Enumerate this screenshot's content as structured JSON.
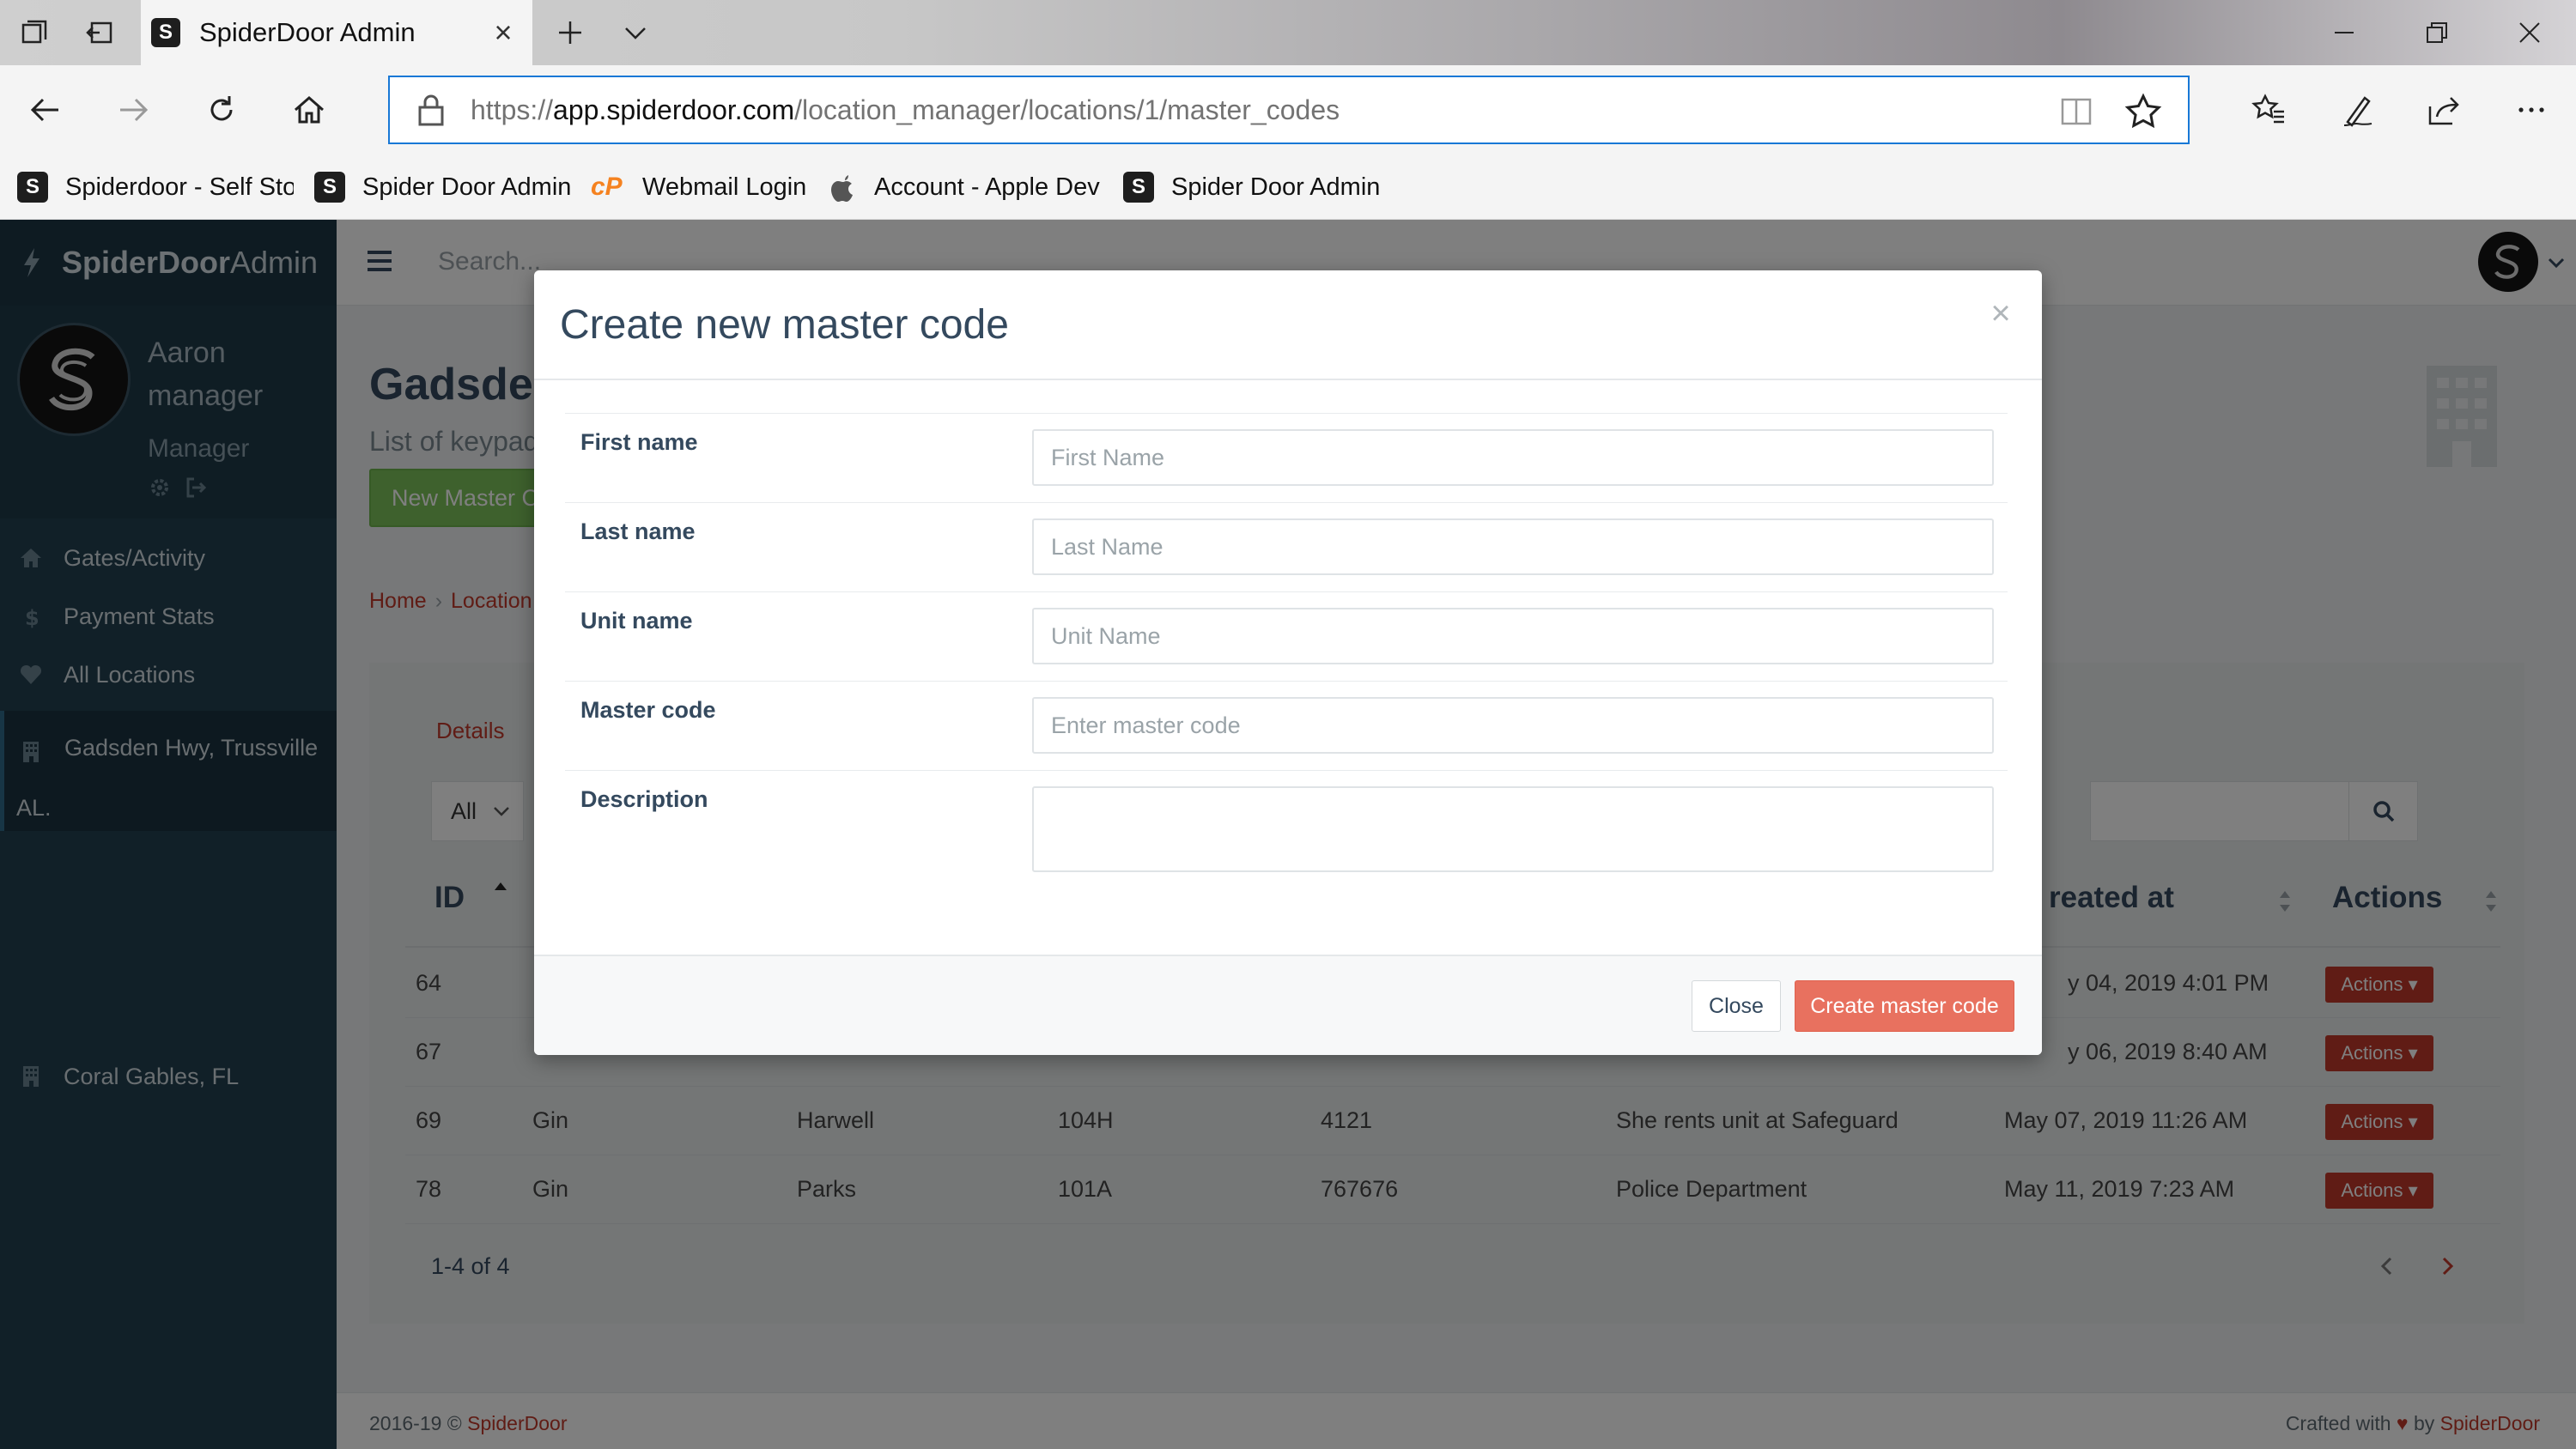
{
  "browser": {
    "tab_title": "SpiderDoor Admin",
    "url_host": "app.spiderdoor.com",
    "url_prefix": "https://",
    "url_path": "/location_manager/locations/1/master_codes",
    "bookmarks": [
      {
        "label": "Spiderdoor - Self Stor",
        "icon": "spiderdoor-favicon"
      },
      {
        "label": "Spider Door Admin",
        "icon": "spiderdoor-favicon"
      },
      {
        "label": "Webmail Login",
        "icon": "cpanel-icon"
      },
      {
        "label": "Account - Apple Deve",
        "icon": "apple-icon"
      },
      {
        "label": "Spider Door Admin",
        "icon": "spiderdoor-favicon"
      }
    ]
  },
  "app": {
    "brand_bold": "SpiderDoor",
    "brand_light": "Admin",
    "search_placeholder": "Search...",
    "user": {
      "name": "Aaron manager",
      "role": "Manager"
    },
    "sidebar": [
      {
        "label": "Gates/Activity",
        "icon": "home-icon"
      },
      {
        "label": "Payment Stats",
        "icon": "dollar-icon"
      },
      {
        "label": "All Locations",
        "icon": "heart-icon"
      },
      {
        "label": "Gadsden Hwy, Trussville",
        "label2": "AL.",
        "icon": "building-icon",
        "active": true
      },
      {
        "label": "Coral Gables, FL",
        "icon": "building-icon"
      }
    ],
    "page_title": "Gadsden",
    "page_subtitle": "List of keypad",
    "new_button": "New Master C",
    "breadcrumb": [
      "Home",
      "Location"
    ],
    "tab_details": "Details",
    "filter_value": "All",
    "table": {
      "headers": {
        "id": "ID",
        "created": "reated at",
        "actions": "Actions"
      },
      "rows": [
        {
          "id": "64",
          "first": "",
          "last": "",
          "unit": "",
          "code": "",
          "desc": "",
          "created": "y 04, 2019 4:01 PM",
          "action": "Actions"
        },
        {
          "id": "67",
          "first": "",
          "last": "",
          "unit": "",
          "code": "",
          "desc": "",
          "created": "y 06, 2019 8:40 AM",
          "action": "Actions"
        },
        {
          "id": "69",
          "first": "Gin",
          "last": "Harwell",
          "unit": "104H",
          "code": "4121",
          "desc": "She rents unit at Safeguard",
          "created": "May 07, 2019 11:26 AM",
          "action": "Actions"
        },
        {
          "id": "78",
          "first": "Gin",
          "last": "Parks",
          "unit": "101A",
          "code": "767676",
          "desc": "Police Department",
          "created": "May 11, 2019 7:23 AM",
          "action": "Actions"
        }
      ]
    },
    "pager": "1-4 of 4",
    "footer_left_prefix": "2016-19 © ",
    "footer_left_link": "SpiderDoor",
    "footer_right_prefix": "Crafted with",
    "footer_right_by": " by ",
    "footer_right_link": "SpiderDoor"
  },
  "modal": {
    "title": "Create new master code",
    "close_x": "×",
    "fields": [
      {
        "label": "First name",
        "placeholder": "First Name"
      },
      {
        "label": "Last name",
        "placeholder": "Last Name"
      },
      {
        "label": "Unit name",
        "placeholder": "Unit Name"
      },
      {
        "label": "Master code",
        "placeholder": "Enter master code"
      },
      {
        "label": "Description",
        "placeholder": ""
      }
    ],
    "close_button": "Close",
    "submit_button": "Create master code"
  },
  "colors": {
    "accent_red": "#c0392b",
    "submit": "#e8715f",
    "sidebar": "#234151",
    "new_button": "#7cc35a"
  }
}
